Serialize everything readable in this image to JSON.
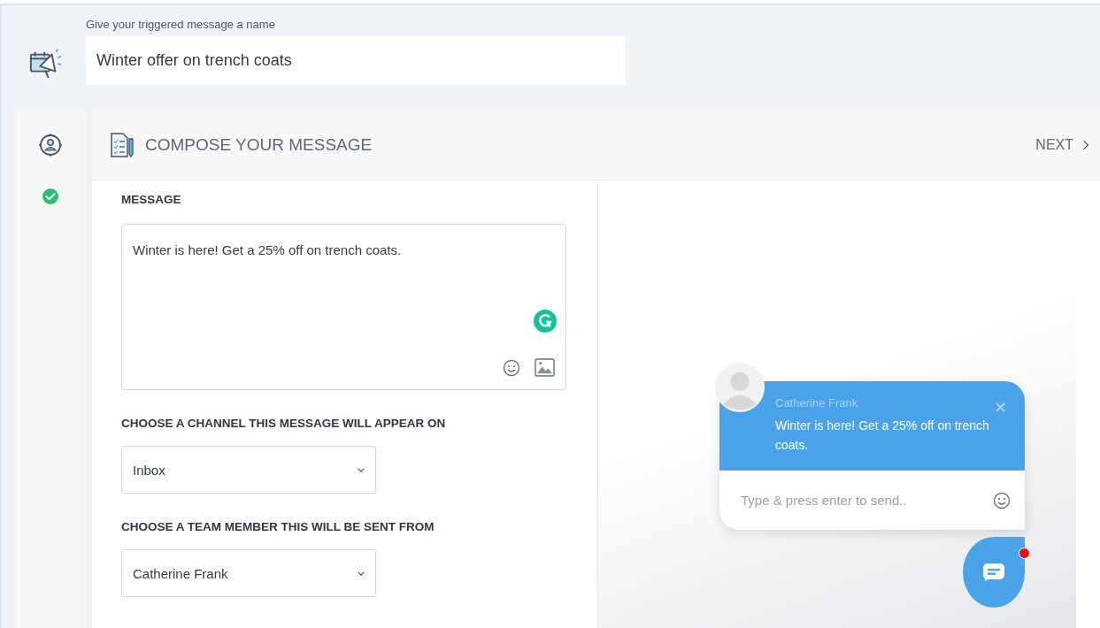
{
  "name_field": {
    "label": "Give your triggered message a name",
    "value": "Winter offer on trench coats"
  },
  "steps": [
    {
      "kind": "audience",
      "completed": false
    },
    {
      "kind": "status",
      "completed": true
    }
  ],
  "panel": {
    "title": "COMPOSE YOUR MESSAGE",
    "next": "NEXT"
  },
  "message": {
    "label": "MESSAGE",
    "value": "Winter is here! Get a 25% off on trench coats."
  },
  "channel": {
    "label": "CHOOSE A CHANNEL THIS MESSAGE WILL APPEAR ON",
    "value": "Inbox"
  },
  "sender": {
    "label": "CHOOSE A TEAM MEMBER THIS WILL BE SENT FROM",
    "value": "Catherine Frank"
  },
  "preview": {
    "sender": "Catherine Frank",
    "message": "Winter is here! Get a 25% off on trench coats.",
    "placeholder": "Type & press enter to send..",
    "unread": true
  }
}
